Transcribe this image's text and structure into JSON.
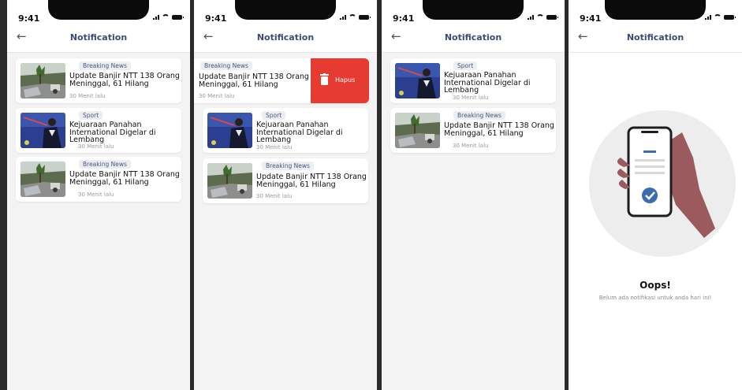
{
  "status": {
    "time": "9:41"
  },
  "header": {
    "title": "Notification"
  },
  "screen1": {
    "items": [
      {
        "category": "Breaking News",
        "headline_line1": "Update Banjir NTT 138 Orang",
        "headline_line2": "Meninggal, 61 Hilang",
        "headline_line3": "",
        "time_ago": "30 Menit lalu",
        "image": "flood"
      },
      {
        "category": "Sport",
        "headline_line1": "Kejuaraan Panahan",
        "headline_line2": "International Digelar di",
        "headline_line3": "Lembang",
        "time_ago": "30 Menit lalu",
        "image": "archery"
      },
      {
        "category": "Breaking News",
        "headline_line1": "Update Banjir NTT 138 Orang",
        "headline_line2": "Meninggal, 61 Hilang",
        "headline_line3": "",
        "time_ago": "30 Menit lalu",
        "image": "flood"
      }
    ]
  },
  "screen2": {
    "swiped": {
      "category": "Breaking News",
      "headline_line1": "Update Banjir NTT 138 Orang",
      "headline_line2": "Meninggal, 61 Hilang",
      "time_ago": "30 Menit lalu",
      "delete_label": "Hapus",
      "delete_color": "#e53b33"
    },
    "items": [
      {
        "category": "Sport",
        "headline_line1": "Kejuaraan Panahan",
        "headline_line2": "International Digelar di",
        "headline_line3": "Lembang",
        "time_ago": "30 Menit lalu",
        "image": "archery"
      },
      {
        "category": "Breaking News",
        "headline_line1": "Update Banjir NTT 138 Orang",
        "headline_line2": "Meninggal, 61 Hilang",
        "headline_line3": "",
        "time_ago": "30 Menit lalu",
        "image": "flood"
      }
    ]
  },
  "screen3": {
    "items": [
      {
        "category": "Sport",
        "headline_line1": "Kejuaraan Panahan",
        "headline_line2": "International Digelar di",
        "headline_line3": "Lembang",
        "time_ago": "30 Menit lalu",
        "image": "archery"
      },
      {
        "category": "Breaking News",
        "headline_line1": "Update Banjir NTT 138 Orang",
        "headline_line2": "Meninggal, 61 Hilang",
        "headline_line3": "",
        "time_ago": "30 Menit lalu",
        "image": "flood"
      }
    ]
  },
  "screen4": {
    "empty_title": "Oops!",
    "empty_message": "Belum ada notifikasi untuk anda hari ini!",
    "illustration": "hand-holding-phone-check-icon"
  },
  "colors": {
    "title": "#3a4b7a",
    "badge_bg": "#eceef4",
    "delete": "#e53b33",
    "illustration_circle": "#ededed",
    "hand": "#9a5a5e",
    "check": "#3c6bb0"
  }
}
